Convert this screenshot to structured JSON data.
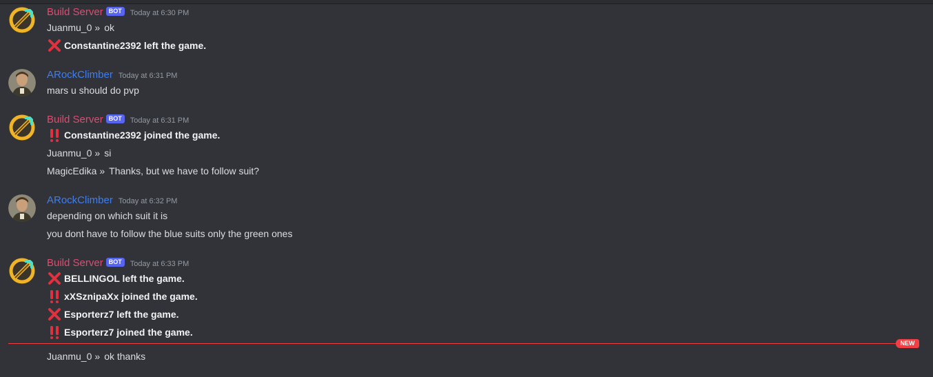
{
  "colors": {
    "background": "#313338",
    "bot_name": "#e24a6f",
    "user_name": "#3f7ef0",
    "bot_tag": "#5865f2",
    "new_divider": "#f23f43"
  },
  "messages": [
    {
      "author": "Build Server",
      "bot_tag": "BOT",
      "timestamp": "Today at 6:30 PM",
      "avatar_icon": "diamond-pickaxe-icon",
      "lines": [
        {
          "type": "chat",
          "user": "Juanmu_0",
          "sep": "»",
          "text": "ok"
        },
        {
          "type": "event",
          "icon": "cross-mark-icon",
          "text": "Constantine2392 left the game."
        }
      ]
    },
    {
      "author": "ARockClimber",
      "timestamp": "Today at 6:31 PM",
      "avatar_icon": "portrait-avatar",
      "lines": [
        {
          "type": "plain",
          "text": "mars u should do pvp"
        }
      ]
    },
    {
      "author": "Build Server",
      "bot_tag": "BOT",
      "timestamp": "Today at 6:31 PM",
      "avatar_icon": "diamond-pickaxe-icon",
      "lines": [
        {
          "type": "event",
          "icon": "double-exclamation-icon",
          "text": "Constantine2392 joined the game."
        },
        {
          "type": "chat",
          "user": "Juanmu_0",
          "sep": "»",
          "text": "si"
        },
        {
          "type": "chat",
          "user": "MagicEdika",
          "sep": "»",
          "text": "Thanks, but we have to follow suit?"
        }
      ]
    },
    {
      "author": "ARockClimber",
      "timestamp": "Today at 6:32 PM",
      "avatar_icon": "portrait-avatar",
      "lines": [
        {
          "type": "plain",
          "text": "depending on which suit it is"
        },
        {
          "type": "plain",
          "text": "you dont have to follow the blue suits only the green ones"
        }
      ]
    },
    {
      "author": "Build Server",
      "bot_tag": "BOT",
      "timestamp": "Today at 6:33 PM",
      "avatar_icon": "diamond-pickaxe-icon",
      "lines": [
        {
          "type": "event",
          "icon": "cross-mark-icon",
          "text": "BELLINGOL left the game."
        },
        {
          "type": "event",
          "icon": "double-exclamation-icon",
          "text": "xXSznipaXx joined the game."
        },
        {
          "type": "event",
          "icon": "cross-mark-icon",
          "text": "Esporterz7 left the game."
        },
        {
          "type": "event",
          "icon": "double-exclamation-icon",
          "text": "Esporterz7 joined the game."
        },
        {
          "type": "chat",
          "user": "Juanmu_0",
          "sep": "»",
          "text": "ok thanks"
        }
      ]
    }
  ],
  "divider": {
    "label": "NEW"
  }
}
